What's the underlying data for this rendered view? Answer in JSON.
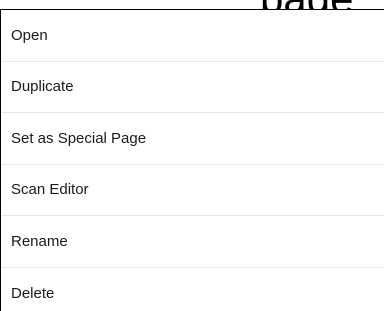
{
  "background": {
    "heading_fragment": "page"
  },
  "context_menu": {
    "items": [
      {
        "label": "Open"
      },
      {
        "label": "Duplicate"
      },
      {
        "label": "Set as Special Page"
      },
      {
        "label": "Scan Editor"
      },
      {
        "label": "Rename"
      },
      {
        "label": "Delete"
      }
    ]
  },
  "colors": {
    "text": "#1a1a1a",
    "divider": "#e6e6e6",
    "border": "#000000",
    "background": "#ffffff"
  }
}
